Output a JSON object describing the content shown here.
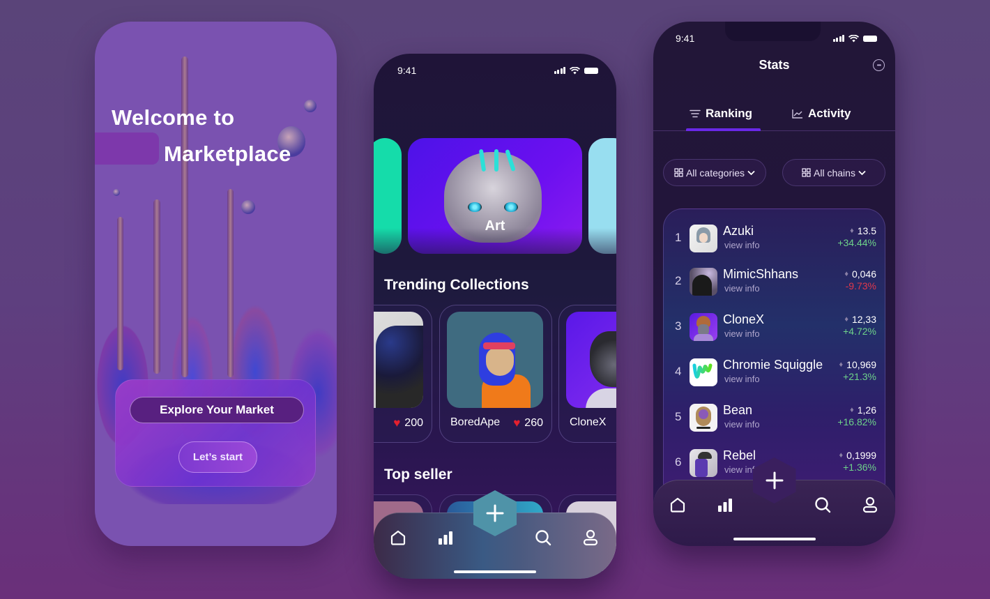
{
  "welcome_screen": {
    "title_line1": "Welcome to",
    "title_line2": "Marketplace",
    "explore_button": "Explore Your Market",
    "start_button": "Let’s start"
  },
  "home_screen": {
    "status_time": "9:41",
    "hero_category": "Art",
    "trending_title": "Trending Collections",
    "collections": [
      {
        "name": "",
        "likes": "200"
      },
      {
        "name": "BoredApe",
        "likes": "260"
      },
      {
        "name": "CloneX",
        "likes": ""
      }
    ],
    "top_seller_title": "Top seller"
  },
  "stats_screen": {
    "status_time": "9:41",
    "title": "Stats",
    "tabs": [
      {
        "label": "Ranking",
        "icon": "filter-lines-icon",
        "active": true
      },
      {
        "label": "Activity",
        "icon": "line-chart-icon",
        "active": false
      }
    ],
    "filters": [
      {
        "label": "All categories",
        "icon": "grid-icon"
      },
      {
        "label": "All chains",
        "icon": "grid-icon"
      }
    ],
    "ranking": [
      {
        "rank": "1",
        "name": "Azuki",
        "sub": "view info",
        "price": "13.5",
        "change": "+34.44%",
        "trend": "up"
      },
      {
        "rank": "2",
        "name": "MimicShhans",
        "sub": "view info",
        "price": "0,046",
        "change": "-9.73%",
        "trend": "down"
      },
      {
        "rank": "3",
        "name": "CloneX",
        "sub": "view info",
        "price": "12,33",
        "change": "+4.72%",
        "trend": "up"
      },
      {
        "rank": "4",
        "name": "Chromie Squiggle",
        "sub": "view info",
        "price": "10,969",
        "change": "+21.3%",
        "trend": "up"
      },
      {
        "rank": "5",
        "name": "Bean",
        "sub": "view info",
        "price": "1,26",
        "change": "+16.82%",
        "trend": "up"
      },
      {
        "rank": "6",
        "name": "Rebel",
        "sub": "view info",
        "price": "0,1999",
        "change": "+1.36%",
        "trend": "up"
      }
    ]
  },
  "tabbar": {
    "items": [
      "home-icon",
      "stats-icon",
      "add-icon",
      "search-icon",
      "profile-icon"
    ]
  },
  "colors": {
    "accent": "#6a28e8",
    "positive": "#6ed28a",
    "negative": "#e0384c",
    "heart": "#e4202e"
  }
}
